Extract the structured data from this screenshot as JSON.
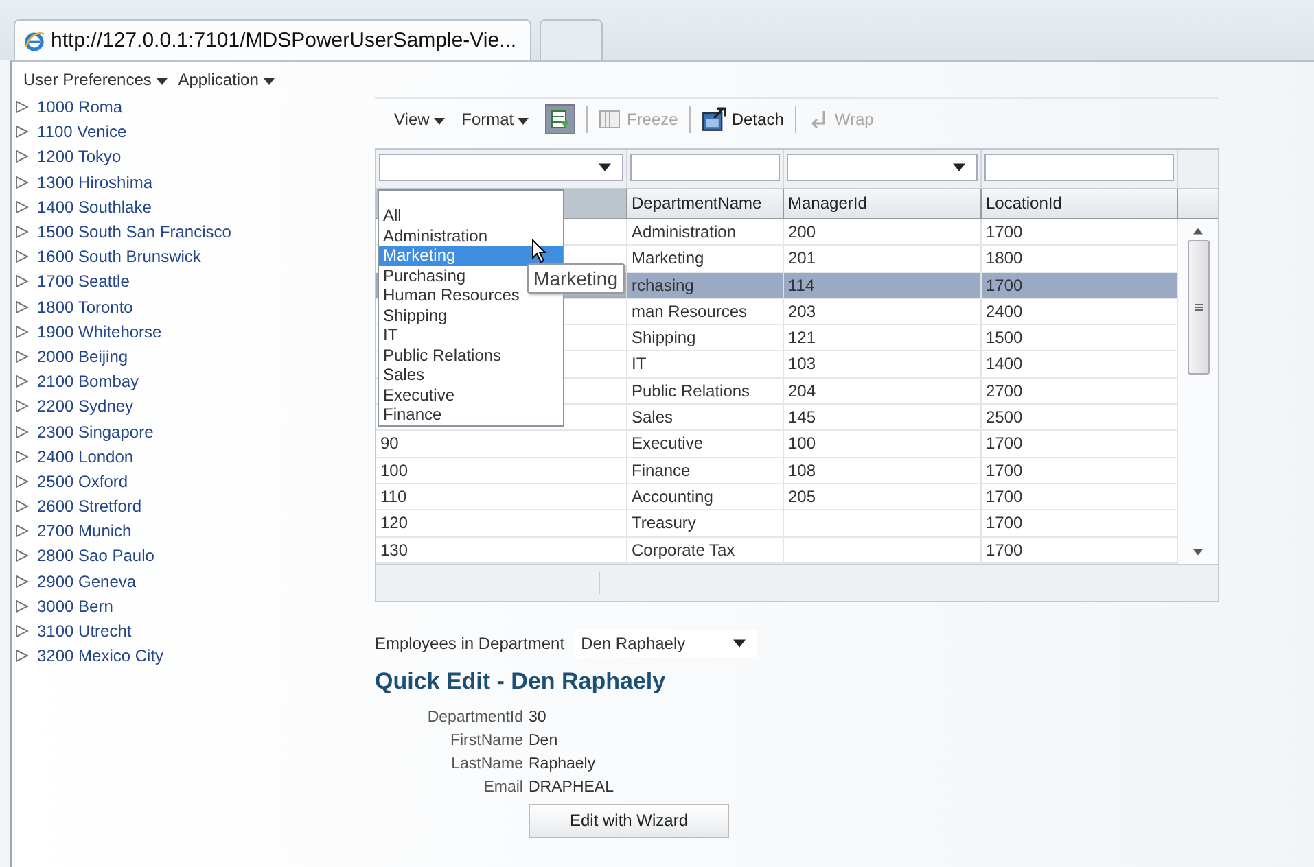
{
  "browser": {
    "tabs": [
      {
        "title": "http://127.0.0.1:7101/MDSPowerUserSample-Vie...",
        "selected": true
      },
      {
        "selected": false
      }
    ]
  },
  "menu": [
    "User Preferences",
    "Application"
  ],
  "sidebar": {
    "items": [
      "1000 Roma",
      "1100 Venice",
      "1200 Tokyo",
      "1300 Hiroshima",
      "1400 Southlake",
      "1500 South San Francisco",
      "1600 South Brunswick",
      "1700 Seattle",
      "1800 Toronto",
      "1900 Whitehorse",
      "2000 Beijing",
      "2100 Bombay",
      "2200 Sydney",
      "2300 Singapore",
      "2400 London",
      "2500 Oxford",
      "2600 Stretford",
      "2700 Munich",
      "2800 Sao Paulo",
      "2900 Geneva",
      "3000 Bern",
      "3100 Utrecht",
      "3200 Mexico City"
    ]
  },
  "toolbar": [
    {
      "kind": "menu",
      "label": "View"
    },
    {
      "kind": "menu",
      "label": "Format"
    },
    {
      "kind": "toggle",
      "selected": true
    },
    {
      "kind": "freeze",
      "label": "Freeze",
      "disabled": true
    },
    {
      "kind": "detach",
      "label": "Detach",
      "disabled": false
    },
    {
      "kind": "wrap",
      "label": "Wrap",
      "disabled": true
    }
  ],
  "table": {
    "columns": [
      {
        "kind": "dropdown"
      },
      {
        "label": "DepartmentName",
        "kind": "text"
      },
      {
        "label": "ManagerId",
        "kind": "dropdown"
      },
      {
        "label": "LocationId",
        "kind": "text"
      }
    ],
    "rows": [
      {
        "cells": [
          null,
          "Administration",
          "200",
          "1700"
        ],
        "selected": false
      },
      {
        "cells": [
          null,
          "Marketing",
          "201",
          "1800"
        ],
        "selected": false
      },
      {
        "cells": [
          null,
          "rchasing",
          "114",
          "1700"
        ],
        "selected": true
      },
      {
        "cells": [
          null,
          "man Resources",
          "203",
          "2400"
        ],
        "selected": false
      },
      {
        "cells": [
          null,
          "Shipping",
          "121",
          "1500"
        ],
        "selected": false
      },
      {
        "cells": [
          null,
          "IT",
          "103",
          "1400"
        ],
        "selected": false
      },
      {
        "cells": [
          null,
          "Public Relations",
          "204",
          "2700"
        ],
        "selected": false
      },
      {
        "cells": [
          null,
          "Sales",
          "145",
          "2500"
        ],
        "selected": false
      },
      {
        "cells": [
          "90",
          "Executive",
          "100",
          "1700"
        ],
        "selected": false
      },
      {
        "cells": [
          "100",
          "Finance",
          "108",
          "1700"
        ],
        "selected": false
      },
      {
        "cells": [
          "110",
          "Accounting",
          "205",
          "1700"
        ],
        "selected": false
      },
      {
        "cells": [
          "120",
          "Treasury",
          null,
          "1700"
        ],
        "selected": false
      },
      {
        "cells": [
          "130",
          "Corporate Tax",
          null,
          "1700"
        ],
        "selected": false
      }
    ]
  },
  "filter_list": {
    "items": [
      {
        "label": "All",
        "selected": false
      },
      {
        "label": "Administration",
        "selected": false
      },
      {
        "label": "Marketing",
        "selected": true
      },
      {
        "label": "Purchasing",
        "selected": false
      },
      {
        "label": "Human Resources",
        "selected": false
      },
      {
        "label": "Shipping",
        "selected": false
      },
      {
        "label": "IT",
        "selected": false
      },
      {
        "label": "Public Relations",
        "selected": false
      },
      {
        "label": "Sales",
        "selected": false
      },
      {
        "label": "Executive",
        "selected": false
      },
      {
        "label": "Finance",
        "selected": false
      }
    ],
    "tooltip": "Marketing"
  },
  "employees": {
    "label": "Employees in Department",
    "value": "Den Raphaely"
  },
  "quick_edit": {
    "title": "Quick Edit - Den Raphaely",
    "fields": [
      {
        "label": "DepartmentId",
        "value": "30"
      },
      {
        "label": "FirstName",
        "value": "Den"
      },
      {
        "label": "LastName",
        "value": "Raphaely"
      },
      {
        "label": "Email",
        "value": "DRAPHEAL"
      }
    ],
    "button": "Edit with Wizard"
  }
}
